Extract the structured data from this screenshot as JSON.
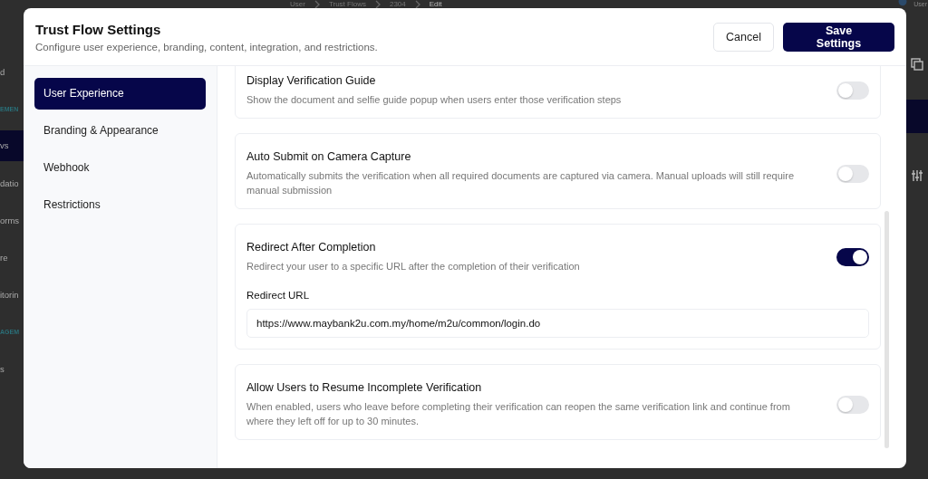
{
  "background": {
    "breadcrumb": [
      "User",
      "Trust Flows",
      "2304",
      "Edit"
    ],
    "user_label": "User",
    "sidebar": [
      {
        "text": "d",
        "kind": "item",
        "selected": false
      },
      {
        "text": "EMEN",
        "kind": "heading",
        "selected": false
      },
      {
        "text": "vs",
        "kind": "item",
        "selected": true
      },
      {
        "text": "datio",
        "kind": "item",
        "selected": false
      },
      {
        "text": "orms",
        "kind": "item",
        "selected": false
      },
      {
        "text": "re",
        "kind": "item",
        "selected": false
      },
      {
        "text": "itorin",
        "kind": "item",
        "selected": false
      },
      {
        "text": "AGEM",
        "kind": "heading",
        "selected": false
      },
      {
        "text": "s",
        "kind": "item",
        "selected": false
      }
    ]
  },
  "modal": {
    "title": "Trust Flow Settings",
    "subtitle": "Configure user experience, branding, content, integration, and restrictions.",
    "buttons": {
      "cancel": "Cancel",
      "save": "Save Settings"
    },
    "nav": [
      {
        "label": "User Experience",
        "selected": true
      },
      {
        "label": "Branding & Appearance",
        "selected": false
      },
      {
        "label": "Webhook",
        "selected": false
      },
      {
        "label": "Restrictions",
        "selected": false
      }
    ],
    "settings": [
      {
        "title": "Display Verification Guide",
        "description": "Show the document and selfie guide popup when users enter those verification steps",
        "on": false
      },
      {
        "title": "Auto Submit on Camera Capture",
        "description": "Automatically submits the verification when all required documents are captured via camera. Manual uploads will still require manual submission",
        "on": false
      },
      {
        "title": "Redirect After Completion",
        "description": "Redirect your user to a specific URL after the completion of their verification",
        "on": true,
        "field": {
          "label": "Redirect URL",
          "value": "https://www.maybank2u.com.my/home/m2u/common/login.do"
        }
      },
      {
        "title": "Allow Users to Resume Incomplete Verification",
        "description": "When enabled, users who leave before completing their verification can reopen the same verification link and continue from where they left off for up to 30 minutes.",
        "on": false
      }
    ]
  }
}
